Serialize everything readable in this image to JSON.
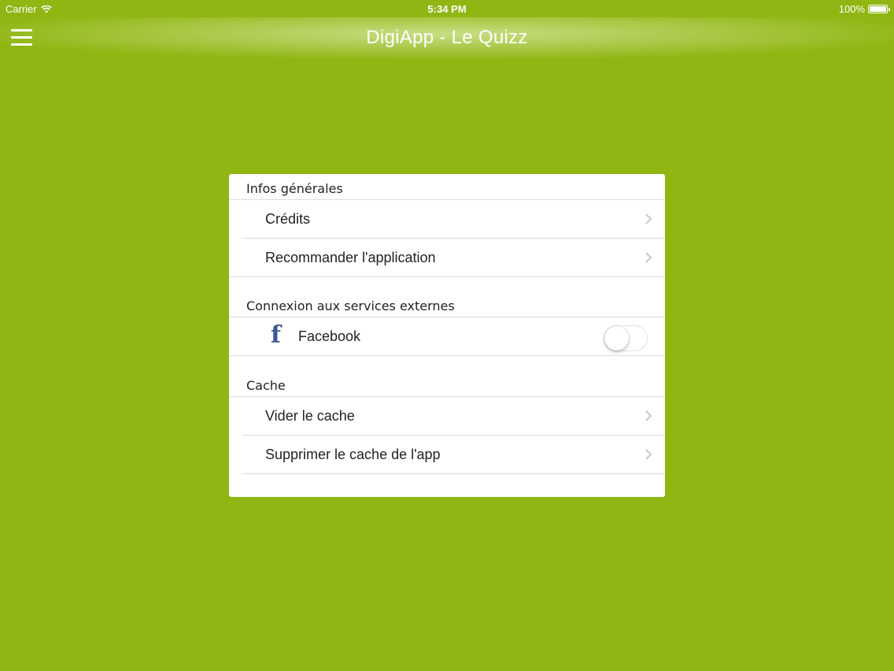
{
  "status_bar": {
    "carrier": "Carrier",
    "time": "5:34 PM",
    "battery": "100%"
  },
  "navbar": {
    "title": "DigiApp - Le Quizz"
  },
  "sections": [
    {
      "header": "Infos générales",
      "items": [
        {
          "label": "Crédits"
        },
        {
          "label": "Recommander l'application"
        }
      ]
    },
    {
      "header": "Connexion aux services externes",
      "items": [
        {
          "label": "Facebook",
          "icon": "facebook-icon",
          "toggle_on": false
        }
      ]
    },
    {
      "header": "Cache",
      "items": [
        {
          "label": "Vider le cache"
        },
        {
          "label": "Supprimer le cache de l'app"
        }
      ]
    }
  ],
  "colors": {
    "background": "#8fb613",
    "facebook": "#3b5998"
  }
}
